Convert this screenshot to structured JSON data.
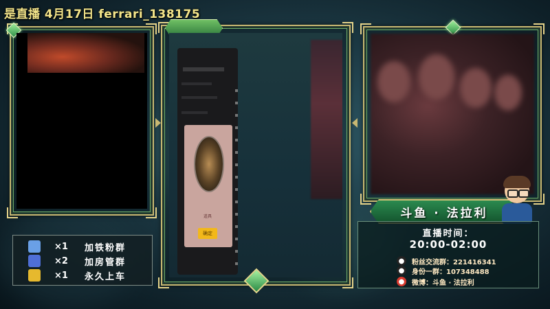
{
  "banner": {
    "text": "是直播  4月17日 ferrari_138175"
  },
  "popup": {
    "small_text": "道具",
    "ok_label": "确定"
  },
  "streamer": {
    "name": "斗鱼 · 法拉利"
  },
  "schedule": {
    "label": "直播时间：",
    "time": "20:00-02:00"
  },
  "contacts": [
    {
      "icon": "qq-icon",
      "text": "粉丝交流群：221416341"
    },
    {
      "icon": "qq-icon",
      "text": "身份一群：107348488"
    },
    {
      "icon": "weibo-icon",
      "text": "微博：斗鱼 · 法拉利"
    }
  ],
  "gifts": [
    {
      "icon": "gift-icon-1",
      "count": "×1",
      "label": "加铁粉群",
      "color": "#6aa0e6"
    },
    {
      "icon": "gift-icon-2",
      "count": "×2",
      "label": "加房管群",
      "color": "#4f6fd6"
    },
    {
      "icon": "gift-icon-3",
      "count": "×1",
      "label": "永久上车",
      "color": "#e6b92e"
    }
  ],
  "colors": {
    "frame_gold": "#c9b872",
    "banner_green": "#2b8a4f",
    "banner_text": "#f4e58a"
  }
}
